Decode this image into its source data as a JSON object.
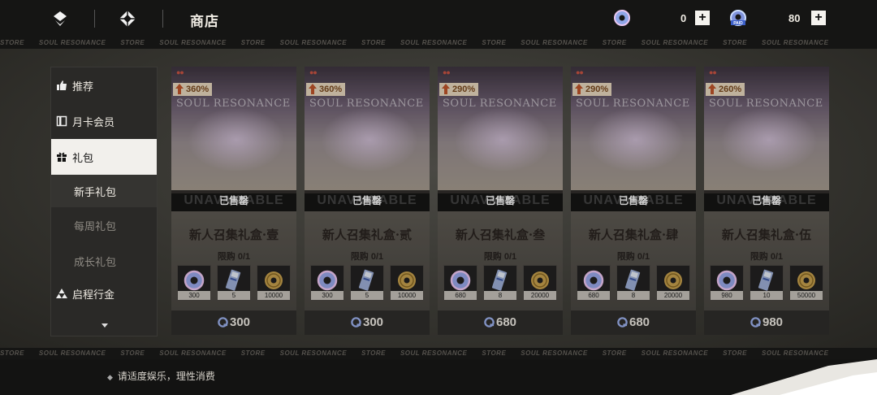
{
  "header": {
    "title": "商店",
    "currencies": [
      {
        "name": "resonance-crystal",
        "value": "0"
      },
      {
        "name": "paid-crystal",
        "value": "80",
        "badge": "PAID"
      }
    ],
    "plus_label": "+"
  },
  "marquee": {
    "words": [
      "STORE",
      "SOUL RESONANCE",
      "STORE",
      "SOUL RESONANCE",
      "STORE",
      "SOUL RESONANCE",
      "STORE",
      "SOUL RESONANCE",
      "STORE",
      "SOUL RESONANCE",
      "STORE",
      "SOUL RESONANCE",
      "STORE",
      "SOUL RESONANCE"
    ]
  },
  "sidebar": {
    "items": [
      {
        "label": "推荐",
        "icon": "thumbs-up-icon"
      },
      {
        "label": "月卡会员",
        "icon": "card-icon"
      },
      {
        "label": "礼包",
        "icon": "gift-icon"
      },
      {
        "label": "新手礼包"
      },
      {
        "label": "每周礼包"
      },
      {
        "label": "成长礼包"
      },
      {
        "label": "启程行金",
        "icon": "triangles-icon"
      }
    ]
  },
  "cards": [
    {
      "bonus": "360%",
      "name": "新人召集礼盒·壹",
      "limit": "限购 0/1",
      "sold": "已售罄",
      "sold_ghost": "UNAVAILABLE",
      "art_logo": "SOUL RESONANCE",
      "items": [
        {
          "qty": "300",
          "icon": "crystal-icon"
        },
        {
          "qty": "5",
          "icon": "ticket-icon"
        },
        {
          "qty": "10000",
          "icon": "coin-icon"
        }
      ],
      "price": "300"
    },
    {
      "bonus": "360%",
      "name": "新人召集礼盒·贰",
      "limit": "限购 0/1",
      "sold": "已售罄",
      "sold_ghost": "UNAVAILABLE",
      "art_logo": "SOUL RESONANCE",
      "items": [
        {
          "qty": "300",
          "icon": "crystal-icon"
        },
        {
          "qty": "5",
          "icon": "ticket-icon"
        },
        {
          "qty": "10000",
          "icon": "coin-icon"
        }
      ],
      "price": "300"
    },
    {
      "bonus": "290%",
      "name": "新人召集礼盒·叁",
      "limit": "限购 0/1",
      "sold": "已售罄",
      "sold_ghost": "UNAVAILABLE",
      "art_logo": "SOUL RESONANCE",
      "items": [
        {
          "qty": "680",
          "icon": "crystal-icon"
        },
        {
          "qty": "8",
          "icon": "ticket-icon"
        },
        {
          "qty": "20000",
          "icon": "coin-icon"
        }
      ],
      "price": "680"
    },
    {
      "bonus": "290%",
      "name": "新人召集礼盒·肆",
      "limit": "限购 0/1",
      "sold": "已售罄",
      "sold_ghost": "UNAVAILABLE",
      "art_logo": "SOUL RESONANCE",
      "items": [
        {
          "qty": "680",
          "icon": "crystal-icon"
        },
        {
          "qty": "8",
          "icon": "ticket-icon"
        },
        {
          "qty": "20000",
          "icon": "coin-icon"
        }
      ],
      "price": "680"
    },
    {
      "bonus": "260%",
      "name": "新人召集礼盒·伍",
      "limit": "限购 0/1",
      "sold": "已售罄",
      "sold_ghost": "UNAVAILABLE",
      "art_logo": "SOUL RESONANCE",
      "items": [
        {
          "qty": "980",
          "icon": "crystal-icon"
        },
        {
          "qty": "10",
          "icon": "ticket-icon"
        },
        {
          "qty": "50000",
          "icon": "coin-icon"
        }
      ],
      "price": "980"
    }
  ],
  "footer": {
    "tip": "请适度娱乐，理性消费"
  }
}
